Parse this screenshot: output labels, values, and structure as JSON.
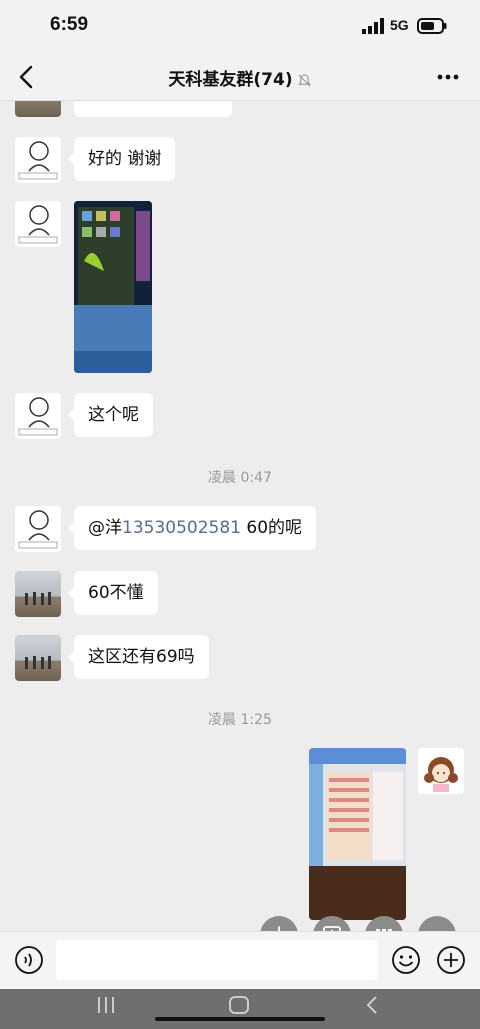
{
  "status_bar": {
    "time": "6:59",
    "network": "5G"
  },
  "header": {
    "title": "天科基友群(74)"
  },
  "messages": [
    {
      "text": "好的 谢谢"
    },
    {
      "text": "这个呢"
    },
    {
      "mention": "@洋",
      "phone": "13530502581",
      "suffix": "60的呢"
    },
    {
      "text": "60不懂"
    },
    {
      "text": "这区还有69吗"
    }
  ],
  "timestamps": [
    "凌晨 0:47",
    "凌晨 1:25"
  ],
  "icons": {
    "back": "chevron-left-icon",
    "mute": "bell-off-icon",
    "more": "more-icon",
    "voice": "voice-icon",
    "emoji": "emoji-icon",
    "plus": "plus-icon"
  },
  "colors": {
    "background": "#ededed",
    "bubble": "#ffffff",
    "link": "#576b95",
    "fab": "#8c8c8c"
  }
}
